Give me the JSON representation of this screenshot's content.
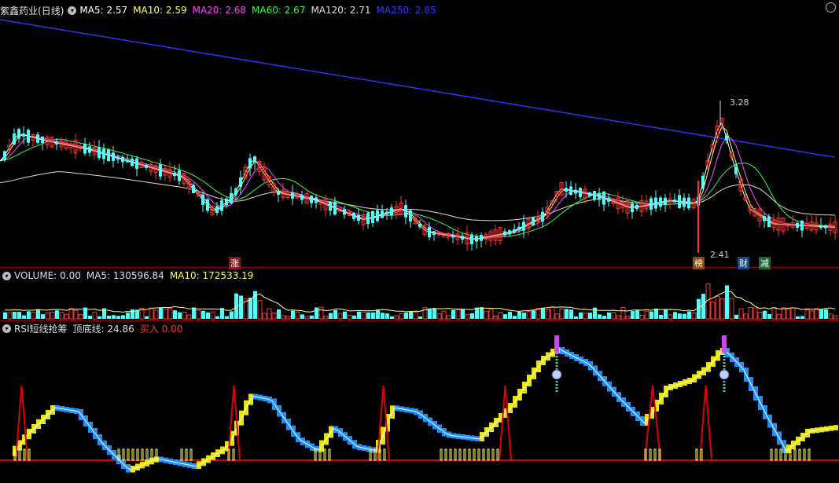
{
  "main": {
    "stock_name": "紫鑫药业",
    "period": "(日线)",
    "ma": [
      {
        "label": "MA5:",
        "value": "2.57",
        "color": "#ffffff"
      },
      {
        "label": "MA10:",
        "value": "2.59",
        "color": "#ffff55"
      },
      {
        "label": "MA20:",
        "value": "2.68",
        "color": "#ff44ff"
      },
      {
        "label": "MA60:",
        "value": "2.67",
        "color": "#33ff33"
      },
      {
        "label": "MA120:",
        "value": "2.71",
        "color": "#dddddd"
      },
      {
        "label": "MA250:",
        "value": "2.85",
        "color": "#3333ff"
      }
    ],
    "high_label": "3.28",
    "low_label": "2.41",
    "tags": [
      {
        "text": "涨",
        "bg": "#cc2222"
      },
      {
        "text": "榜",
        "bg": "#cc6600"
      },
      {
        "text": "财",
        "bg": "#1166cc"
      },
      {
        "text": "减",
        "bg": "#229944"
      }
    ]
  },
  "volume": {
    "label": "VOLUME:",
    "value": "0.00",
    "ma5_label": "MA5:",
    "ma5_value": "130596.84",
    "ma10_label": "MA10:",
    "ma10_value": "172533.19"
  },
  "rsi": {
    "name": "RSI短线抢筹",
    "line_label": "顶底线:",
    "line_value": "24.86",
    "buy_label": "买入",
    "buy_value": "0.00"
  },
  "colors": {
    "up": "#ff3333",
    "down": "#54ffff",
    "ma250": "#3333ff",
    "ma60": "#33ff33",
    "ma20": "#ff44ff",
    "ma10": "#ffff55",
    "ma5": "#ffffff",
    "rsi_up": "#e6e600",
    "rsi_down": "#1e90ff",
    "signal": "#dd0000"
  }
}
